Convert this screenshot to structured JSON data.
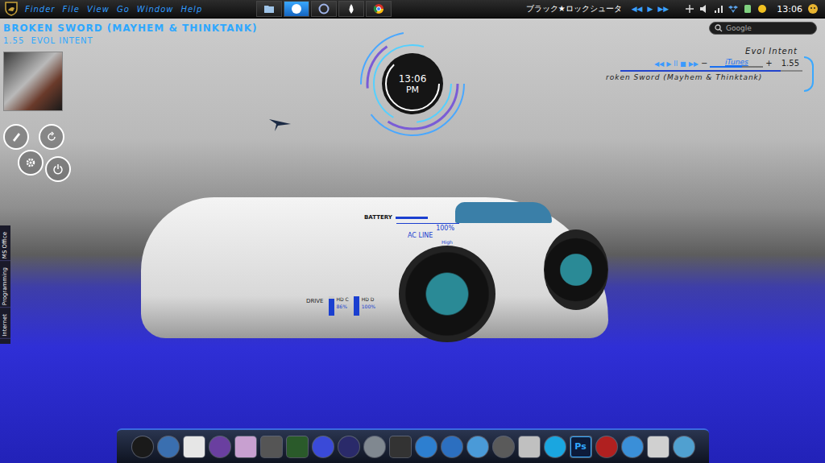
{
  "menubar": {
    "items": [
      "Finder",
      "File",
      "View",
      "Go",
      "Window",
      "Help"
    ]
  },
  "taskbar": [
    {
      "kind": "folder",
      "selected": false
    },
    {
      "kind": "skype",
      "selected": true
    },
    {
      "kind": "disc",
      "selected": false
    },
    {
      "kind": "drop",
      "selected": false
    },
    {
      "kind": "chrome",
      "selected": false
    }
  ],
  "status": {
    "song": "ブラック★ロックシュータ",
    "controls": [
      "◀◀",
      "▶",
      "▶▶"
    ],
    "tray": [
      {
        "kind": "expand"
      },
      {
        "kind": "volume"
      },
      {
        "kind": "signal"
      },
      {
        "kind": "dropbox"
      },
      {
        "kind": "usb"
      },
      {
        "kind": "chat"
      }
    ],
    "clock": "13:06"
  },
  "now_playing": {
    "title": "BROKEN SWORD (MAYHEM & THINKTANK)",
    "subtitle": "1.55  EVOL INTENT"
  },
  "quick_buttons": [
    {
      "kind": "edit"
    },
    {
      "kind": "refresh"
    },
    {
      "kind": "settings"
    },
    {
      "kind": "power"
    }
  ],
  "clock_widget": {
    "time": "13:06",
    "period": "PM"
  },
  "search": {
    "placeholder": "Google"
  },
  "itunes": {
    "artist": "Evol Intent",
    "controls": [
      "◀◀",
      "▶",
      "II",
      "■",
      "▶▶"
    ],
    "volume_down": "−",
    "volume_up": "+",
    "label": "iTunes",
    "time": "1.55",
    "volume": 0.6,
    "progress": 0.88,
    "track": "roken Sword (Mayhem & Thinktank)"
  },
  "battery": {
    "label": "BATTERY",
    "reading": "100%",
    "level": 1,
    "source": "AC LINE",
    "mode": "High"
  },
  "drives": {
    "label": "DRIVE",
    "items": [
      {
        "name": "HD C",
        "reading": "86%",
        "level": 0.86
      },
      {
        "name": "HD D",
        "reading": "100%",
        "level": 1
      }
    ]
  },
  "side_tabs": [
    "MS Office",
    "Programming",
    "Internet"
  ],
  "dock": [
    {
      "kind": "circle",
      "color": "#1a1a1a"
    },
    {
      "kind": "circle",
      "color": "#3a6fb0"
    },
    {
      "kind": "square",
      "color": "#e6e6e6"
    },
    {
      "kind": "circle",
      "color": "#6a3fa0"
    },
    {
      "kind": "square",
      "color": "#c8a0d0"
    },
    {
      "kind": "square",
      "color": "#555555"
    },
    {
      "kind": "square",
      "color": "#2a5a2a"
    },
    {
      "kind": "circle",
      "color": "#3a4ad8"
    },
    {
      "kind": "circle",
      "color": "#2a2a6a"
    },
    {
      "kind": "circle",
      "color": "#808890"
    },
    {
      "kind": "square",
      "color": "#333333"
    },
    {
      "kind": "circle",
      "color": "#2d7fd0"
    },
    {
      "kind": "circle",
      "color": "#2c6fc0"
    },
    {
      "kind": "circle",
      "color": "#4a9ad8"
    },
    {
      "kind": "circle",
      "color": "#5a5a5a"
    },
    {
      "kind": "square",
      "color": "#c0c0c0"
    },
    {
      "kind": "circle",
      "color": "#1aa6e0"
    },
    {
      "kind": "text",
      "color": "#0d1b3a",
      "glyph": "Ps"
    },
    {
      "kind": "circle",
      "color": "#b02020"
    },
    {
      "kind": "circle",
      "color": "#3a8fd8"
    },
    {
      "kind": "square",
      "color": "#d0d0d0"
    },
    {
      "kind": "circle",
      "color": "#50a0d0"
    }
  ]
}
